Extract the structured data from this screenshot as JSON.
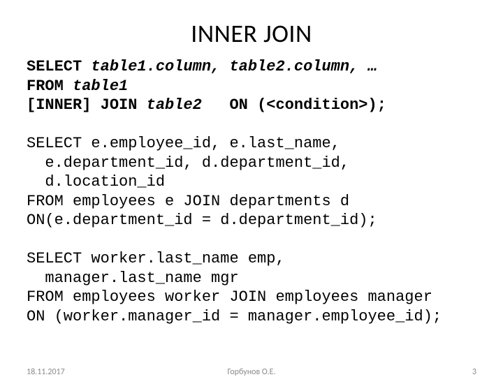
{
  "title": "INNER JOIN",
  "syntax": {
    "kw_select": "SELECT ",
    "sel_cols": "table1.column, table2.column, …",
    "kw_from": "FROM ",
    "from_tbl": "table1",
    "kw_join": "[INNER] JOIN ",
    "join_tbl": "table2",
    "on_clause": "   ON (<condition>);"
  },
  "example1": {
    "l1": "SELECT e.employee_id, e.last_name,",
    "l2": "  e.department_id, d.department_id,",
    "l3": "  d.location_id",
    "l4": "FROM employees e JOIN departments d",
    "l5": "ON(e.department_id = d.department_id);"
  },
  "example2": {
    "l1": "SELECT worker.last_name emp,",
    "l2": "  manager.last_name mgr",
    "l3": "FROM employees worker JOIN employees manager",
    "l4": "ON (worker.manager_id = manager.employee_id);"
  },
  "footer": {
    "date": "18.11.2017",
    "author": "Горбунов О.Е.",
    "page": "3"
  }
}
